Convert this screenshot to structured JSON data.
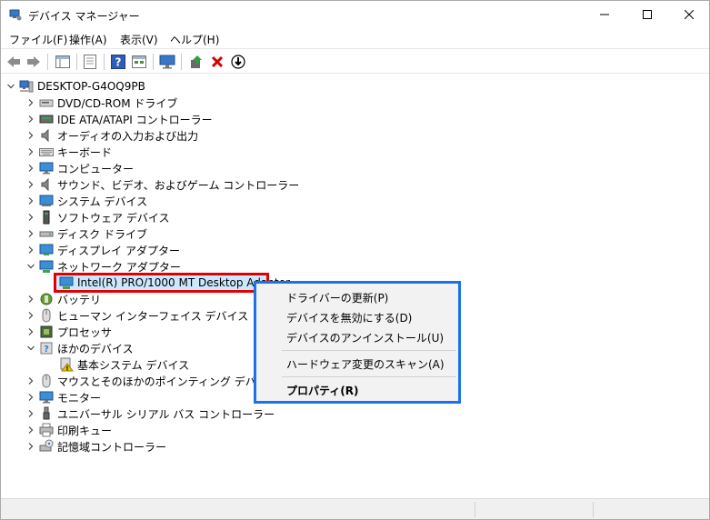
{
  "window": {
    "title": "デバイス マネージャー"
  },
  "menu": {
    "file": "ファイル(F)",
    "action": "操作(A)",
    "view": "表示(V)",
    "help": "ヘルプ(H)"
  },
  "tree": {
    "root": "DESKTOP-G4OQ9PB",
    "items": [
      {
        "label": "DVD/CD-ROM ドライブ",
        "icon": "dvd-icon"
      },
      {
        "label": "IDE ATA/ATAPI コントローラー",
        "icon": "ide-controller-icon"
      },
      {
        "label": "オーディオの入力および出力",
        "icon": "speaker-icon"
      },
      {
        "label": "キーボード",
        "icon": "keyboard-icon"
      },
      {
        "label": "コンピューター",
        "icon": "computer-icon"
      },
      {
        "label": "サウンド、ビデオ、およびゲーム コントローラー",
        "icon": "sound-icon"
      },
      {
        "label": "システム デバイス",
        "icon": "system-device-icon"
      },
      {
        "label": "ソフトウェア デバイス",
        "icon": "software-device-icon"
      },
      {
        "label": "ディスク ドライブ",
        "icon": "disk-drive-icon"
      },
      {
        "label": "ディスプレイ アダプター",
        "icon": "display-adapter-icon"
      },
      {
        "label": "ネットワーク アダプター",
        "icon": "network-adapter-icon"
      },
      {
        "label": "Intel(R) PRO/1000 MT Desktop Adapter",
        "icon": "network-card-icon"
      },
      {
        "label": "バッテリ",
        "icon": "battery-icon"
      },
      {
        "label": "ヒューマン インターフェイス デバイス",
        "icon": "hid-icon"
      },
      {
        "label": "プロセッサ",
        "icon": "processor-icon"
      },
      {
        "label": "ほかのデバイス",
        "icon": "unknown-device-icon"
      },
      {
        "label": "基本システム デバイス",
        "icon": "warning-device-icon"
      },
      {
        "label": "マウスとそのほかのポインティング デバイス",
        "icon": "mouse-icon"
      },
      {
        "label": "モニター",
        "icon": "monitor-icon"
      },
      {
        "label": "ユニバーサル シリアル バス コントローラー",
        "icon": "usb-icon"
      },
      {
        "label": "印刷キュー",
        "icon": "printer-icon"
      },
      {
        "label": "記憶域コントローラー",
        "icon": "storage-controller-icon"
      }
    ]
  },
  "context_menu": {
    "update_driver": "ドライバーの更新(P)",
    "disable_device": "デバイスを無効にする(D)",
    "uninstall_device": "デバイスのアンインストール(U)",
    "scan_hardware": "ハードウェア変更のスキャン(A)",
    "properties": "プロパティ(R)"
  },
  "colors": {
    "selection_border": "#e00000",
    "context_border": "#1a73e8",
    "selection_fill": "#cce8ff"
  }
}
